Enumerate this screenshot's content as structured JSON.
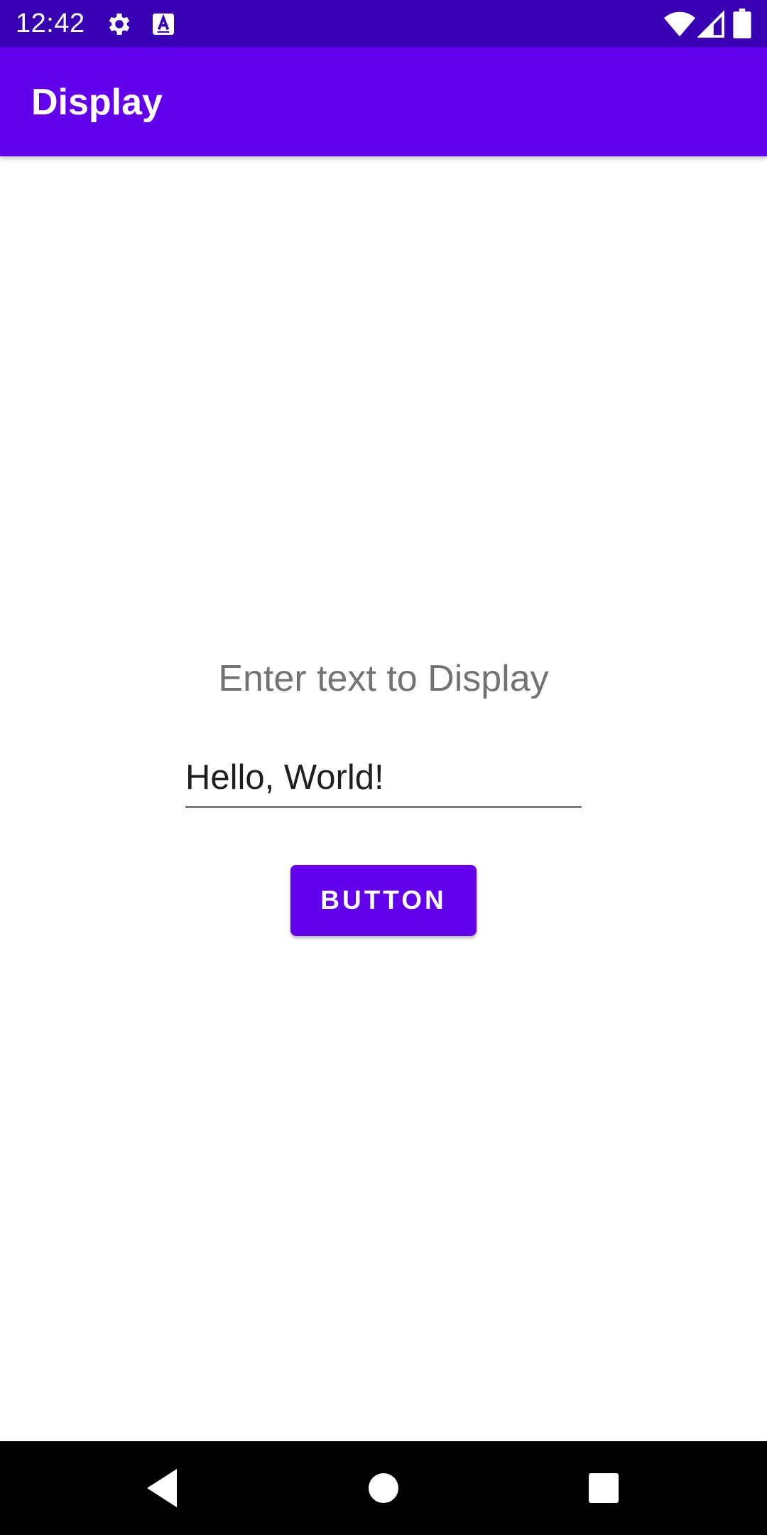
{
  "status_bar": {
    "time": "12:42",
    "icons": [
      "gear-icon",
      "keyboard-a-icon",
      "wifi-icon",
      "signal-icon",
      "battery-icon"
    ],
    "background": "#3700B3"
  },
  "app_bar": {
    "title": "Display",
    "background": "#6200EE"
  },
  "main": {
    "prompt": "Enter text to Display",
    "input_value": "Hello, World!",
    "button_label": "BUTTON",
    "accent": "#6200EE"
  },
  "nav_bar": {
    "icons": [
      "back-icon",
      "home-icon",
      "recents-icon"
    ]
  }
}
